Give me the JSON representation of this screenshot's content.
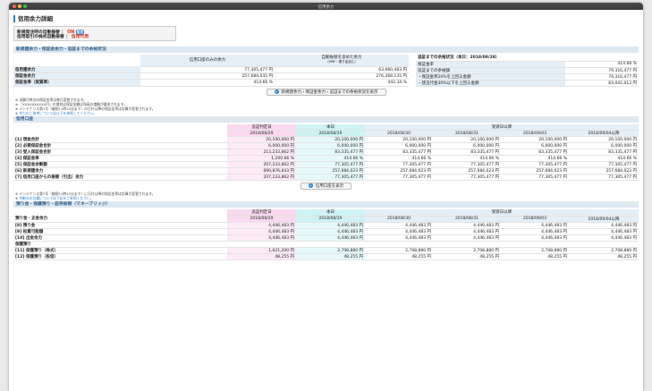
{
  "window": {
    "title": "信用余力"
  },
  "page_title": "信用余力詳細",
  "settings": {
    "row1_label": "新規発注時の自動振替",
    "row1_value": "ON",
    "row1_badge": "設定",
    "row2_label": "信用取引の株式自動振替",
    "row2_value": "信用代用"
  },
  "section1": {
    "title": "新規建余力・保証金余力・追証までの余裕状況",
    "col_a": "信用口座のみの余力",
    "col_b": "自動振替を含めた余力",
    "col_b_sub": "(MRF・預り金含む)",
    "rows": [
      {
        "label": "信用建余力",
        "a": "77,305,477 円",
        "b": "63,660,483 円"
      },
      {
        "label": "保証金余力",
        "a": "257,684,035 円",
        "b": "276,268,135 円"
      },
      {
        "label": "保証金率（実質率）",
        "a": "414.66 %",
        "b": "442.34 %"
      }
    ],
    "side_title": "追証までの余裕状況（本日：2018/08/28）",
    "side_rows": [
      {
        "label": "保証金率",
        "value": "414.66 %"
      },
      {
        "label": "追証までの余裕額",
        "value": "79,316,477 円"
      },
      {
        "label": "・保証金率20%を上回る金額",
        "value": "79,316,477 円"
      },
      {
        "label": "・建玉代金30%以下を上回る金額",
        "value": "83,042,012 円"
      }
    ],
    "button": "新規建余力・保証金余力・追証までの余裕状況を表示"
  },
  "notes1": [
    "決算日時点の保証金率は毎日変更されます。",
    "「XXXXXXXXXX円」の場合は保証金額は残高の増額が要求されます。",
    "メンテナンス第7号（継続11時15分まで）の日付以降の保証金率は計算が変更されます。",
    "余力のご参考については以下を参照してください。"
  ],
  "section2": {
    "title": "信用口座",
    "hdr_overdue": "追証判定日",
    "hdr_today": "本日",
    "hdr_future": "受渡日以降",
    "dates": [
      "2018/08/29",
      "2018/08/29",
      "2018/08/30",
      "2018/08/31",
      "2018/09/03",
      "2018/09/04以降"
    ],
    "rows": [
      {
        "label": "[1] 現金合計",
        "v": [
          "20,100,000 円",
          "20,100,000 円",
          "20,100,000 円",
          "20,100,000 円",
          "20,100,000 円",
          "20,100,000 円"
        ]
      },
      {
        "label": "[2] 必要保証金合計",
        "v": [
          "6,000,000 円",
          "6,000,000 円",
          "6,000,000 円",
          "6,000,000 円",
          "6,000,000 円",
          "6,000,000 円"
        ]
      },
      {
        "label": "[3] 受入保証金合計",
        "v": [
          "213,233,862 円",
          "83,335,477 円",
          "83,335,477 円",
          "83,335,477 円",
          "83,335,477 円",
          "83,335,477 円"
        ]
      },
      {
        "label": "[4] 保証金率",
        "v": [
          "1,200.66 %",
          "414.66 %",
          "414.66 %",
          "414.66 %",
          "414.66 %",
          "414.66 %"
        ]
      },
      {
        "label": "[5] 保証金余剰額",
        "v": [
          "207,233,862 円",
          "77,305,477 円",
          "77,305,477 円",
          "77,305,477 円",
          "77,305,477 円",
          "77,305,477 円"
        ]
      },
      {
        "label": "[6] 新規建余力",
        "v": [
          "690,876,643 円",
          "257,684,023 円",
          "257,684,023 円",
          "257,684,023 円",
          "257,684,023 円",
          "257,684,023 円"
        ]
      },
      {
        "label": "[7] 信用口座からの振替（引出）余力",
        "v": [
          "207,233,862 円",
          "77,305,477 円",
          "77,305,477 円",
          "77,305,477 円",
          "77,305,477 円",
          "77,305,477 円"
        ]
      }
    ],
    "button": "信用口座を表示"
  },
  "notes2": [
    "メンテナンス第7号（継続11時15分まで）に日付以降の保証金率は計算が変更されます。",
    "余剰分の計算については下記をご参照ください。"
  ],
  "section3": {
    "title": "預り金・保護預り・証券振替（マネーブリッジ）",
    "hdr_overdue": "追証判定日",
    "hdr_today": "本日",
    "hdr_future": "受渡日以降",
    "dates": [
      "2018/08/29",
      "2018/08/29",
      "2018/08/30",
      "2018/08/31",
      "2018/09/03",
      "2018/09/04以降"
    ],
    "group1": "預り金・支金余力",
    "rows": [
      {
        "label": "[8] 預り金",
        "v": [
          "4,446,483 円",
          "4,446,483 円",
          "4,446,483 円",
          "4,446,483 円",
          "4,446,483 円",
          "4,446,483 円"
        ]
      },
      {
        "label": "[9] 投資可能額",
        "v": [
          "4,446,483 円",
          "4,446,483 円",
          "4,446,483 円",
          "4,446,483 円",
          "4,446,483 円",
          "4,446,483 円"
        ]
      },
      {
        "label": "[10] 出金余力",
        "v": [
          "4,446,483 円",
          "4,446,483 円",
          "4,446,483 円",
          "4,446,483 円",
          "4,446,483 円",
          "4,446,483 円"
        ]
      }
    ],
    "group2": "保護預り",
    "rows2": [
      {
        "label": "[11] 保護預り（株式）",
        "v": [
          "1,621,200 円",
          "2,708,880 円",
          "2,708,880 円",
          "2,708,880 円",
          "2,708,880 円",
          "2,708,880 円"
        ]
      },
      {
        "label": "[12] 保護預り（投信）",
        "v": [
          "48,255 円",
          "48,255 円",
          "48,255 円",
          "48,255 円",
          "48,255 円",
          "48,255 円"
        ]
      }
    ]
  }
}
